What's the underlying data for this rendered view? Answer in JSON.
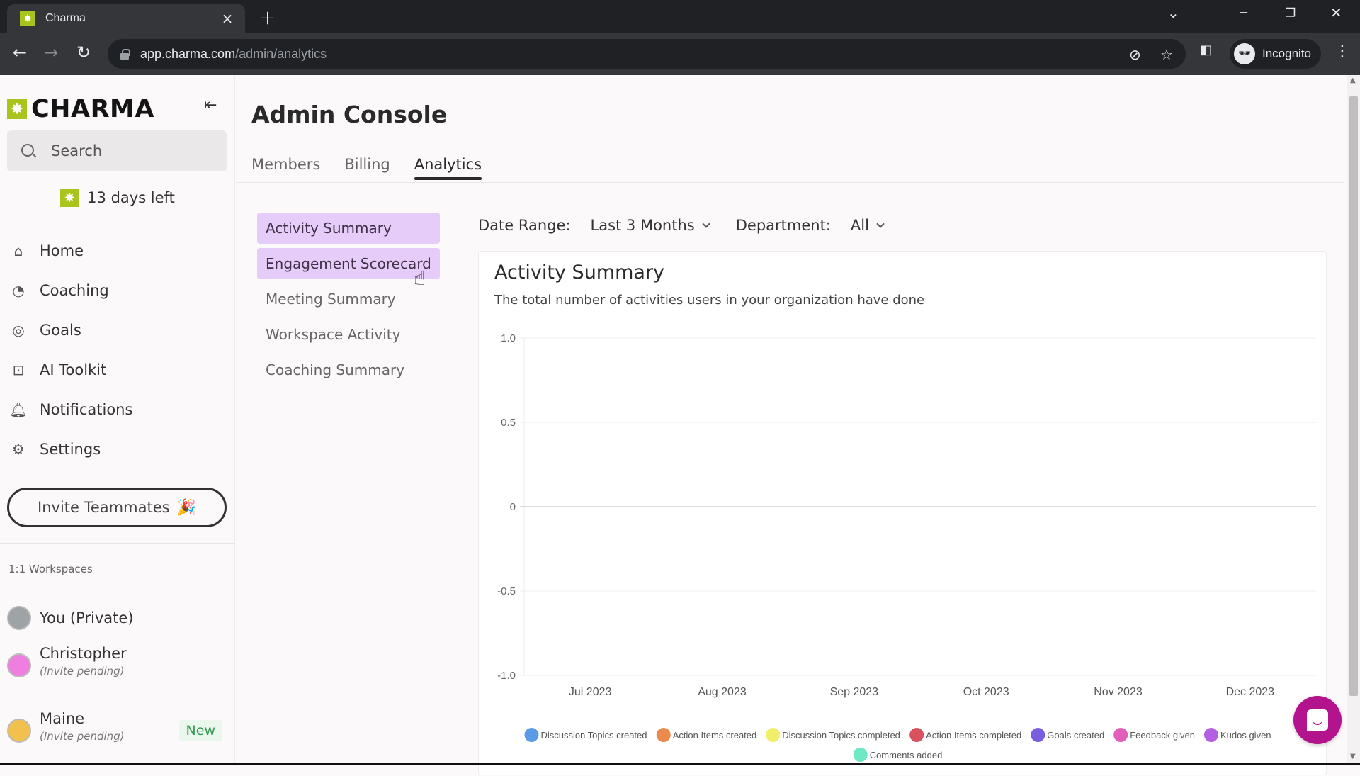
{
  "browser": {
    "tab_title": "Charma",
    "url_host": "app.charma.com",
    "url_path": "/admin/analytics",
    "profile_label": "Incognito"
  },
  "sidebar": {
    "logo_text": "CHARMA",
    "search_placeholder": "Search",
    "trial_text": "13 days left",
    "nav": [
      {
        "label": "Home",
        "icon": "home-icon"
      },
      {
        "label": "Coaching",
        "icon": "whistle-icon"
      },
      {
        "label": "Goals",
        "icon": "target-icon"
      },
      {
        "label": "AI Toolkit",
        "icon": "robot-icon"
      },
      {
        "label": "Notifications",
        "icon": "bell-icon"
      },
      {
        "label": "Settings",
        "icon": "gear-icon"
      }
    ],
    "invite_label": "Invite Teammates",
    "invite_emoji": "🎉",
    "workspaces_heading": "1:1 Workspaces",
    "workspaces": [
      {
        "name": "You (Private)",
        "sub": "",
        "badge": "",
        "avatar_color": "#9ea3a5"
      },
      {
        "name": "Christopher",
        "sub": "(Invite pending)",
        "badge": "",
        "avatar_color": "#ee7fe0"
      },
      {
        "name": "Maine",
        "sub": "(Invite pending)",
        "badge": "New",
        "avatar_color": "#f2c04d"
      }
    ]
  },
  "main": {
    "page_title": "Admin Console",
    "tabs": [
      {
        "label": "Members",
        "active": false
      },
      {
        "label": "Billing",
        "active": false
      },
      {
        "label": "Analytics",
        "active": true
      }
    ],
    "subnav": [
      {
        "label": "Activity Summary",
        "state": "selected"
      },
      {
        "label": "Engagement Scorecard",
        "state": "hover"
      },
      {
        "label": "Meeting Summary",
        "state": ""
      },
      {
        "label": "Workspace Activity",
        "state": ""
      },
      {
        "label": "Coaching Summary",
        "state": ""
      }
    ],
    "filters": {
      "date_label": "Date Range:",
      "date_value": "Last 3 Months",
      "dept_label": "Department:",
      "dept_value": "All"
    },
    "card": {
      "title": "Activity Summary",
      "description": "The total number of activities users in your organization have done"
    }
  },
  "chart_data": {
    "type": "line",
    "title": "Activity Summary",
    "xlabel": "",
    "ylabel": "",
    "categories": [
      "Jul 2023",
      "Aug 2023",
      "Sep 2023",
      "Oct 2023",
      "Nov 2023",
      "Dec 2023"
    ],
    "yticks": [
      "1.0",
      "0.5",
      "0",
      "-0.5",
      "-1.0"
    ],
    "ytick_values": [
      1.0,
      0.5,
      0,
      -0.5,
      -1.0
    ],
    "ylim": [
      -1.0,
      1.0
    ],
    "grid": true,
    "legend_position": "bottom",
    "series": [
      {
        "name": "Discussion Topics created",
        "color": "#5b9be6",
        "values": []
      },
      {
        "name": "Action Items created",
        "color": "#ea8a4c",
        "values": []
      },
      {
        "name": "Discussion Topics completed",
        "color": "#f0ee6a",
        "values": []
      },
      {
        "name": "Action Items completed",
        "color": "#d9505f",
        "values": []
      },
      {
        "name": "Goals created",
        "color": "#7b5ee0",
        "values": []
      },
      {
        "name": "Feedback given",
        "color": "#e15fb8",
        "values": []
      },
      {
        "name": "Kudos given",
        "color": "#b35fe2",
        "values": []
      },
      {
        "name": "Comments added",
        "color": "#6ee8c5",
        "values": []
      }
    ]
  }
}
